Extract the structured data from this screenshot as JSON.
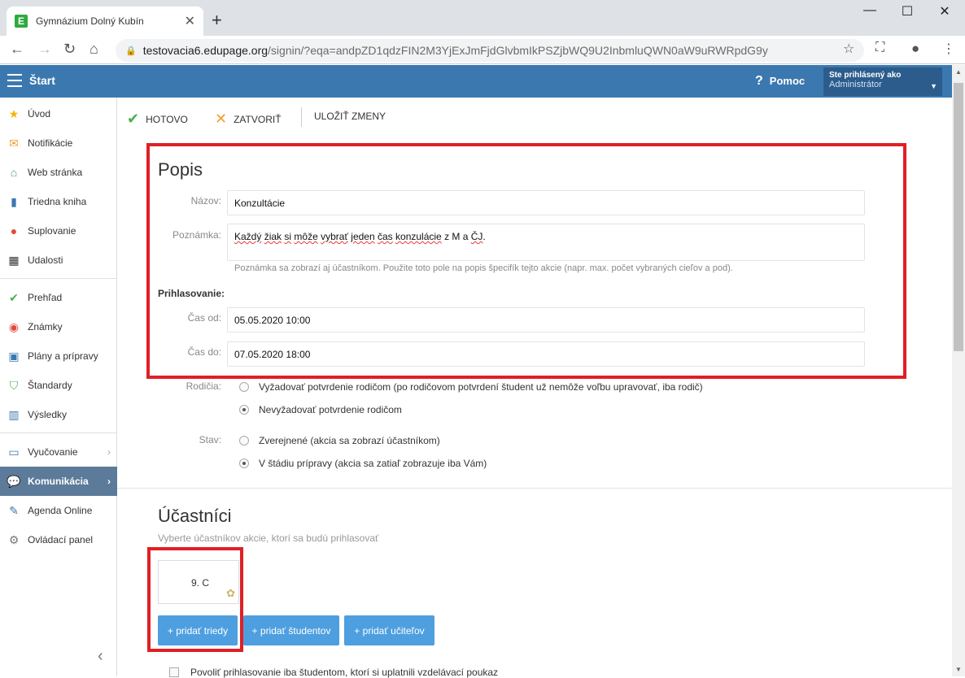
{
  "browser": {
    "tab_title": "Gymnázium Dolný Kubín",
    "favicon_letter": "E",
    "url_host": "testovacia6.edupage.org",
    "url_path": "/signin/?eqa=andpZD1qdzFIN2M3YjExJmFjdGlvbmIkPSZjbWQ9U2InbmluQWN0aW9uRWRpdG9y"
  },
  "header": {
    "title": "Štart",
    "help": "Pomoc",
    "login_label": "Ste prihlásený ako",
    "login_user": "Administrátor"
  },
  "sidebar": {
    "items": [
      {
        "label": "Úvod",
        "icon": "star-icon"
      },
      {
        "label": "Notifikácie",
        "icon": "envelope-icon"
      },
      {
        "label": "Web stránka",
        "icon": "home-icon"
      },
      {
        "label": "Triedna kniha",
        "icon": "book-icon"
      },
      {
        "label": "Suplovanie",
        "icon": "person-icon"
      },
      {
        "label": "Udalosti",
        "icon": "calendar-icon"
      },
      {
        "label": "Prehľad",
        "icon": "check-circle-icon"
      },
      {
        "label": "Známky",
        "icon": "grades-icon"
      },
      {
        "label": "Plány a prípravy",
        "icon": "briefcase-icon"
      },
      {
        "label": "Štandardy",
        "icon": "shield-icon"
      },
      {
        "label": "Výsledky",
        "icon": "bar-chart-icon"
      },
      {
        "label": "Vyučovanie",
        "icon": "open-book-icon"
      },
      {
        "label": "Komunikácia",
        "icon": "chat-icon"
      },
      {
        "label": "Agenda Online",
        "icon": "pen-icon"
      },
      {
        "label": "Ovládací panel",
        "icon": "gear-icon"
      }
    ]
  },
  "actions": {
    "done": "HOTOVO",
    "close": "ZATVORIŤ",
    "save": "ULOŽIŤ ZMENY"
  },
  "popis": {
    "title": "Popis",
    "name_label": "Názov:",
    "name_value": "Konzultácie",
    "note_label": "Poznámka:",
    "note_parts": [
      "Každý",
      " ",
      "žiak",
      " ",
      "si",
      " ",
      "môže",
      " ",
      "vybrať",
      " ",
      "jeden",
      " ",
      "čas",
      " ",
      "konzulácie",
      " z M a ",
      "ČJ",
      "."
    ],
    "note_hint": "Poznámka sa zobrazí aj účastníkom. Použite toto pole na popis špecifík tejto akcie (napr. max. počet vybraných cieľov a pod).",
    "signup_label": "Prihlasovanie:",
    "from_label": "Čas od:",
    "from_value": "05.05.2020 10:00",
    "to_label": "Čas do:",
    "to_value": "07.05.2020 18:00",
    "parents_label": "Rodičia:",
    "parents_opt1": "Vyžadovať potvrdenie rodičom (po rodičovom potvrdení študent už nemôže voľbu upravovať, iba rodič)",
    "parents_opt2": "Nevyžadovať potvrdenie rodičom",
    "state_label": "Stav:",
    "state_opt1": "Zverejnené (akcia sa zobrazí účastníkom)",
    "state_opt2": "V štádiu prípravy (akcia sa zatiaľ zobrazuje iba Vám)"
  },
  "participants": {
    "title": "Účastníci",
    "subtitle": "Vyberte účastníkov akcie, ktorí sa budú prihlasovať",
    "chip": "9. C",
    "add_classes": "+ pridať triedy",
    "add_students": "+ pridať študentov",
    "add_teachers": "+ pridať učiteľov",
    "checkbox": "Povoliť prihlasovanie iba študentom, ktorí si uplatnili vzdelávací poukaz"
  }
}
